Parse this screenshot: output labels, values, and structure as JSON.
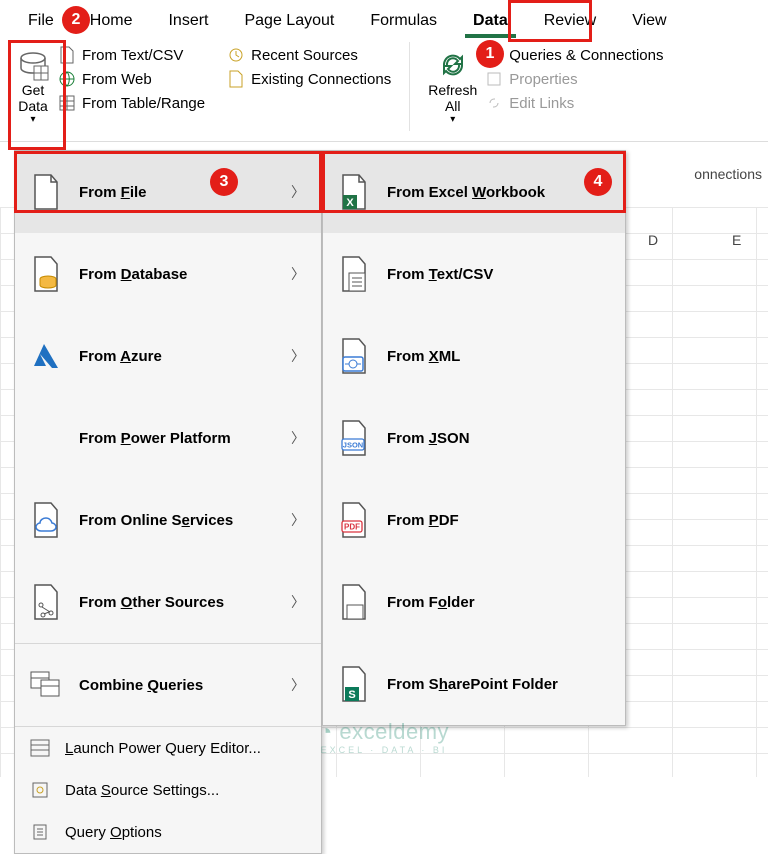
{
  "tabs": {
    "file": "File",
    "home": "Home",
    "insert": "Insert",
    "pagelayout": "Page Layout",
    "formulas": "Formulas",
    "data": "Data",
    "review": "Review",
    "view": "View"
  },
  "ribbon": {
    "getdata": "Get\nData",
    "fromtextcsv": "From Text/CSV",
    "fromweb": "From Web",
    "fromtable": "From Table/Range",
    "recentsources": "Recent Sources",
    "existingconn": "Existing Connections",
    "refresh": "Refresh\nAll",
    "queriesconn": "Queries & Connections",
    "properties": "Properties",
    "editlinks": "Edit Links",
    "connections": "onnections"
  },
  "menu1": {
    "file_pre": "From ",
    "file_u": "F",
    "file_post": "ile",
    "db_pre": "From ",
    "db_u": "D",
    "db_post": "atabase",
    "az_pre": "From ",
    "az_u": "A",
    "az_post": "zure",
    "pp_pre": "From ",
    "pp_u": "P",
    "pp_post": "ower Platform",
    "os_pre": "From Online S",
    "os_u": "e",
    "os_post": "rvices",
    "ot_pre": "From ",
    "ot_u": "O",
    "ot_post": "ther Sources",
    "cq_pre": "Combine ",
    "cq_u": "Q",
    "cq_post": "ueries",
    "launch_u": "L",
    "launch_post": "aunch Power Query Editor...",
    "dss_pre": "Data ",
    "dss_u": "S",
    "dss_post": "ource Settings...",
    "qo_pre": "Query ",
    "qo_u": "O",
    "qo_post": "ptions"
  },
  "menu2": {
    "wb_pre": "From Excel ",
    "wb_u": "W",
    "wb_post": "orkbook",
    "tc_pre": "From ",
    "tc_u": "T",
    "tc_post": "ext/CSV",
    "xml_pre": "From ",
    "xml_u": "X",
    "xml_post": "ML",
    "json_pre": "From ",
    "json_u": "J",
    "json_post": "SON",
    "pdf_pre": "From ",
    "pdf_u": "P",
    "pdf_post": "DF",
    "fld_pre": "From F",
    "fld_u": "o",
    "fld_post": "lder",
    "sp_pre": "From S",
    "sp_u": "h",
    "sp_post": "arePoint Folder"
  },
  "cols": {
    "d": "D",
    "e": "E"
  },
  "bubbles": {
    "b1": "1",
    "b2": "2",
    "b3": "3",
    "b4": "4"
  },
  "watermark": "exceldemy",
  "watermark_sub": "EXCEL · DATA · BI"
}
